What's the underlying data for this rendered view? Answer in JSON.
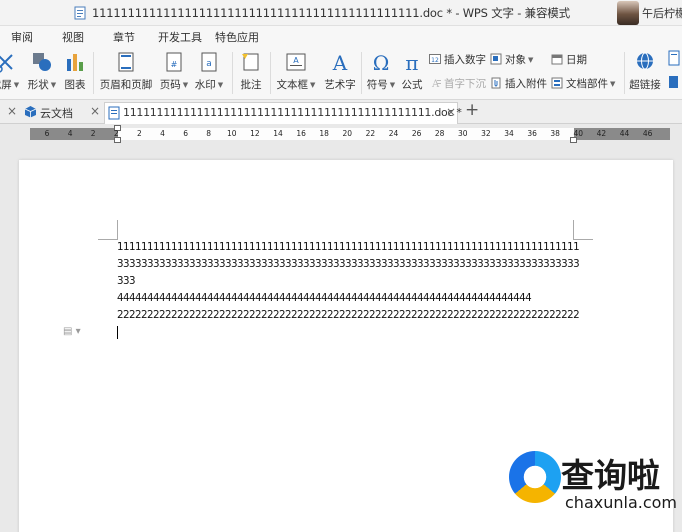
{
  "window": {
    "title": "1111111111111111111111111111111111111111111111.doc * - WPS 文字 - 兼容模式",
    "user_name": "午后柠檬"
  },
  "menu_tabs": [
    "审阅",
    "视图",
    "章节",
    "开发工具",
    "特色应用"
  ],
  "toolbar": {
    "screenshot": "截屏",
    "shapes": "形状",
    "chart": "图表",
    "header_footer": "页眉和页脚",
    "page_number": "页码",
    "watermark": "水印",
    "comment": "批注",
    "text_box": "文本框",
    "word_art": "艺术字",
    "symbol": "符号",
    "formula": "公式",
    "insert_number": "插入数字",
    "object": "对象",
    "date": "日期",
    "drop_cap": "首字下沉",
    "insert_attachment": "插入附件",
    "doc_parts": "文档部件",
    "hyperlink": "超链接"
  },
  "tabs": {
    "cloud_docs": "云文档",
    "active_doc": "1111111111111111111111111111111111111111111111.doc *",
    "new_tab": "+"
  },
  "ruler": {
    "labels": [
      "6",
      "4",
      "2",
      "2",
      "2",
      "4",
      "6",
      "8",
      "10",
      "12",
      "14",
      "16",
      "18",
      "20",
      "22",
      "24",
      "26",
      "28",
      "30",
      "32",
      "34",
      "36",
      "38",
      "40",
      "42",
      "44",
      "46"
    ]
  },
  "document": {
    "lines": [
      "11111111111111111111111111111111111111111111111111111111111111111111111111111",
      "33333333333333333333333333333333333333333333333333333333333333333333333333333",
      "333",
      "444444444444444444444444444444444444444444444444444444444444444444444",
      "22222222222222222222222222222222222222222222222222222222222222222222222222222"
    ]
  },
  "watermark": {
    "brand_cn": "查询啦",
    "brand_url": "chaxunla.com"
  },
  "colors": {
    "accent": "#1a73e8",
    "toolbar_bg": "#f7f7f7",
    "ruler_dark": "#8a8a8a"
  }
}
